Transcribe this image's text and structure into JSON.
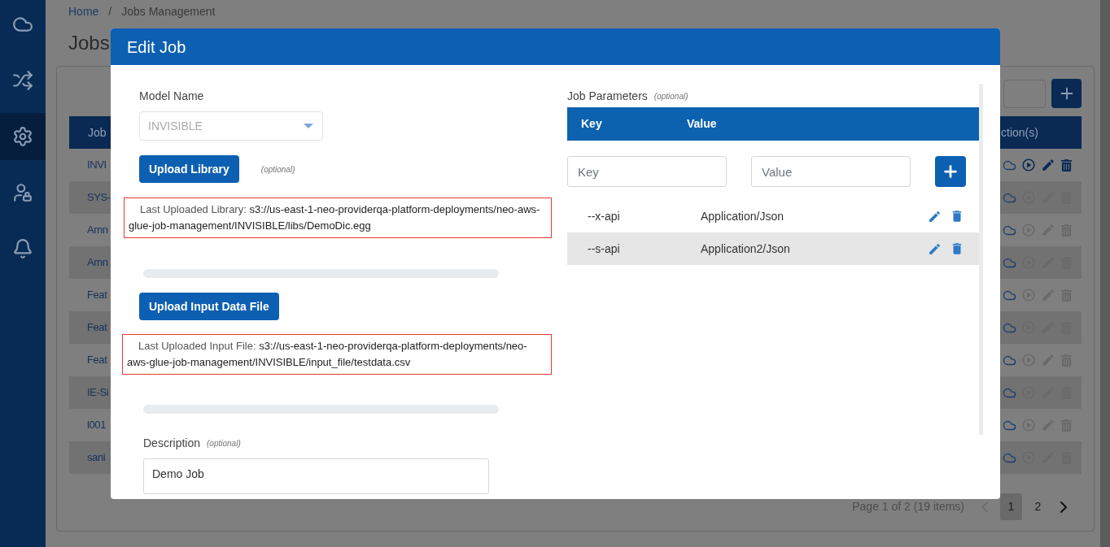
{
  "sidebar": {
    "items": [
      {
        "kind": "cloud",
        "selected": false
      },
      {
        "kind": "shuffle",
        "selected": false
      },
      {
        "kind": "gear",
        "selected": true
      },
      {
        "kind": "user-lock",
        "selected": false
      },
      {
        "kind": "bell",
        "selected": false
      }
    ]
  },
  "breadcrumb": {
    "items": [
      "Home",
      "Jobs Management"
    ],
    "separator": "/"
  },
  "page_title": "Jobs",
  "table": {
    "columns": [
      "Job",
      "ction(s)"
    ],
    "rows": [
      {
        "column_1": "INVI",
        "disabled": false
      },
      {
        "column_1": "SYS-",
        "disabled": true
      },
      {
        "column_1": "Amn",
        "disabled": true
      },
      {
        "column_1": "Amn",
        "disabled": true
      },
      {
        "column_1": "Feat",
        "disabled": true
      },
      {
        "column_1": "Feat",
        "disabled": true
      },
      {
        "column_1": "Feat",
        "disabled": true
      },
      {
        "column_1": "IE-Si",
        "disabled": true
      },
      {
        "column_1": "l001",
        "disabled": true
      },
      {
        "column_1": "sani",
        "disabled": true
      }
    ]
  },
  "pagination": {
    "summary": "Page 1 of 2 (19 items)",
    "previous_disabled": true,
    "pages": [
      {
        "label": "1",
        "selected": true
      },
      {
        "label": "2",
        "selected": false
      }
    ]
  },
  "modal": {
    "title": "Edit Job",
    "model_name": {
      "label": "Model Name",
      "value": "INVISIBLE",
      "disabled": true
    },
    "upload_library": {
      "button": "Upload Library",
      "hint": "(optional)"
    },
    "last_library": {
      "label": "Last Uploaded Library:",
      "value": "s3://us-east-1-neo-providerqa-platform-deployments/neo-aws-glue-job-management/INVISIBLE/libs/DemoDic.egg"
    },
    "library_progress": {
      "level": 0
    },
    "upload_input": {
      "button": "Upload Input Data File"
    },
    "last_input": {
      "label": "Last Uploaded Input File:",
      "value": "s3://us-east-1-neo-providerqa-platform-deployments/neo-aws-glue-job-management/INVISIBLE/input_file/testdata.csv"
    },
    "input_progress": {
      "level": 0
    },
    "description": {
      "label": "Description",
      "hint": "(optional)",
      "value": "Demo Job"
    },
    "job_parameters": {
      "label": "Job Parameters",
      "hint": "(optional)",
      "columns": [
        "Key",
        "Value"
      ],
      "key_placeholder": "Key",
      "value_placeholder": "Value",
      "rows": [
        {
          "key": "--x-api",
          "value": "Application/Json",
          "selected": false
        },
        {
          "key": "--s-api",
          "value": "Application2/Json",
          "selected": true
        }
      ]
    }
  }
}
